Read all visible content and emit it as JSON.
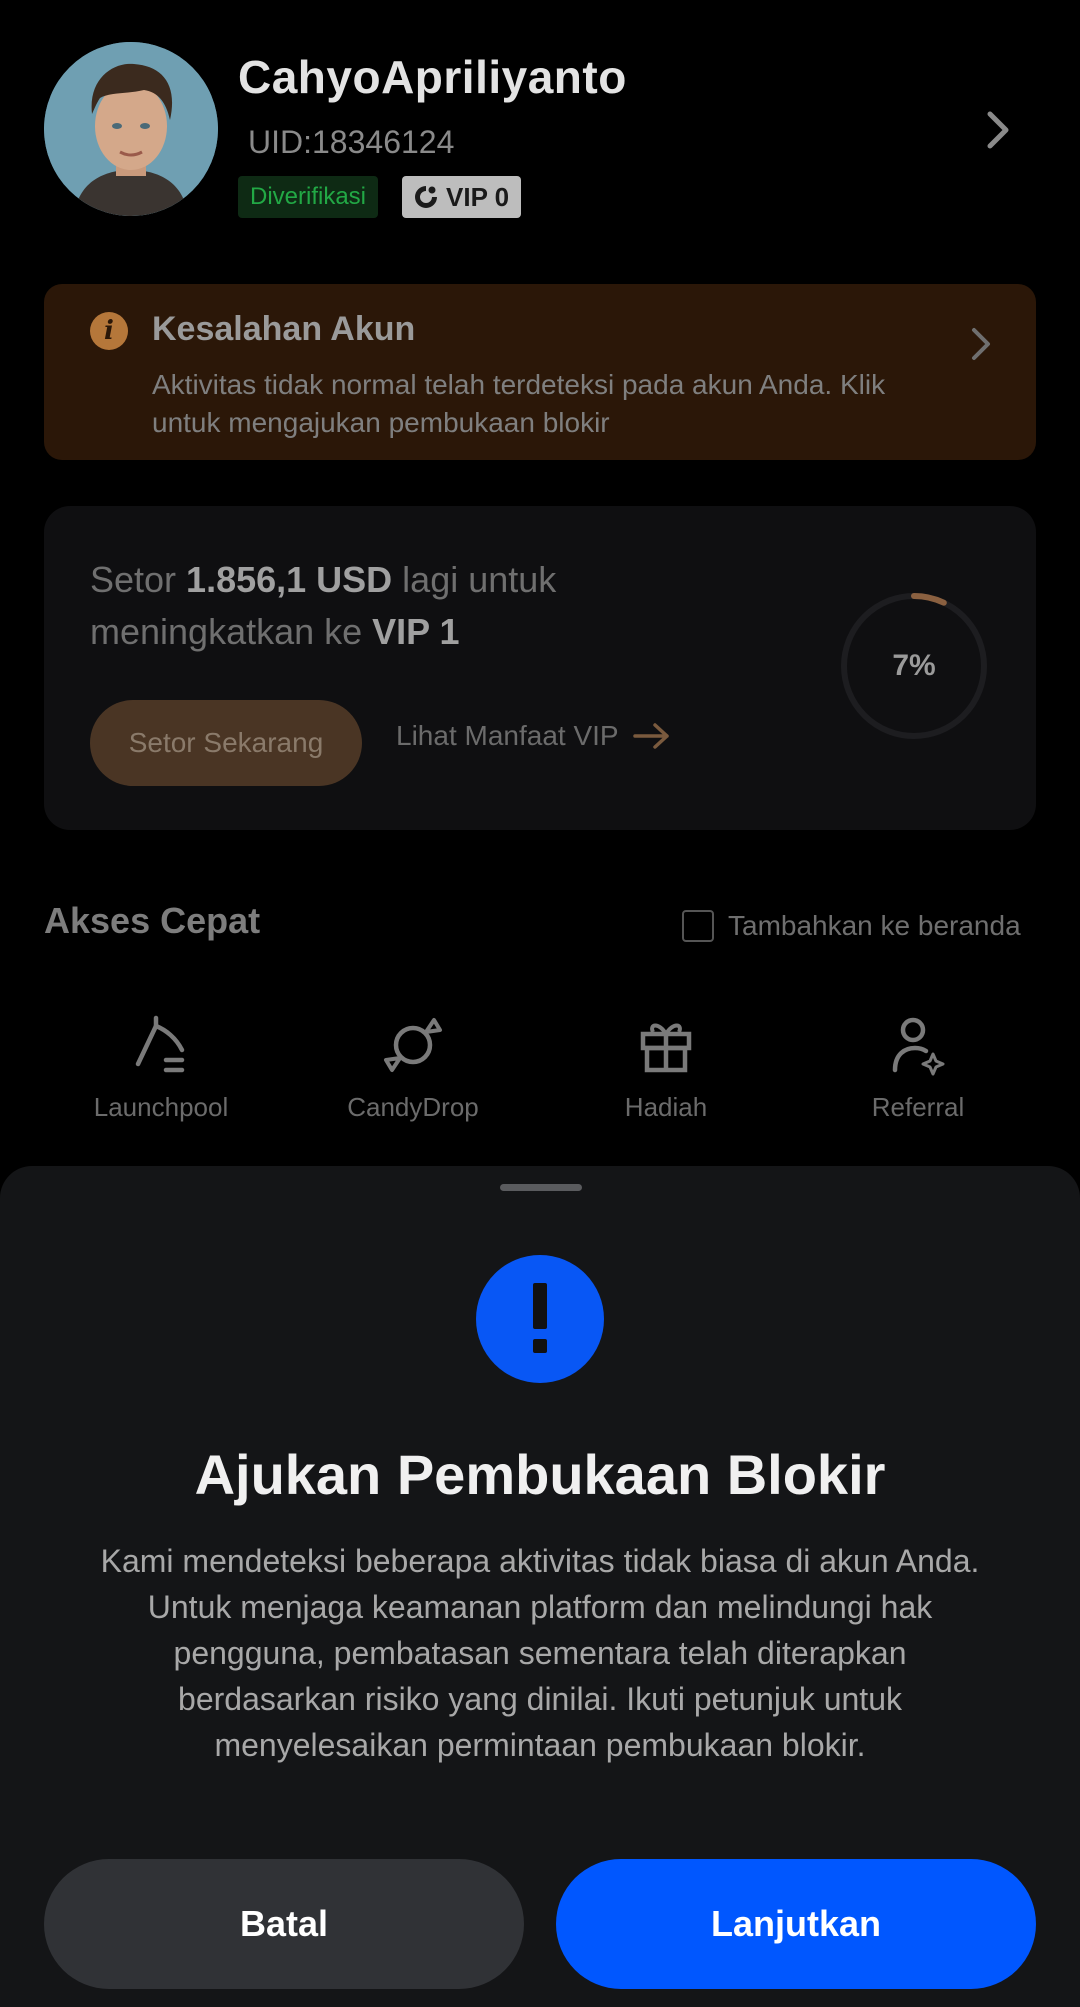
{
  "profile": {
    "username": "CahyoApriliyanto",
    "uid": "UID:18346124",
    "verified_label": "Diverifikasi",
    "vip_label": "VIP 0",
    "avatar_icon": "user-avatar-photo",
    "chevron_icon": "chevron-right-icon"
  },
  "alert": {
    "icon": "info-icon",
    "icon_glyph": "i",
    "title": "Kesalahan Akun",
    "text": "Aktivitas tidak normal telah terdeteksi pada akun Anda. Klik untuk mengajukan pembukaan blokir",
    "chevron_icon": "chevron-right-icon"
  },
  "vip_card": {
    "text_prefix": "Setor ",
    "amount": "1.856,1 USD",
    "text_middle": " lagi untuk meningkatkan ke ",
    "target_level": "VIP 1",
    "deposit_button": "Setor Sekarang",
    "benefit_link": "Lihat Manfaat VIP",
    "progress_label": "7%",
    "progress_fraction": 0.07
  },
  "quick_access": {
    "title": "Akses Cepat",
    "checkbox_label": "Tambahkan ke beranda",
    "items": [
      {
        "label": "Launchpool",
        "icon": "launchpool-icon"
      },
      {
        "label": "CandyDrop",
        "icon": "candy-icon"
      },
      {
        "label": "Hadiah",
        "icon": "gift-icon"
      },
      {
        "label": "Referral",
        "icon": "referral-user-icon"
      }
    ]
  },
  "sheet": {
    "icon": "exclamation-icon",
    "title": "Ajukan Pembukaan Blokir",
    "text": "Kami mendeteksi beberapa aktivitas tidak biasa di akun Anda. Untuk menjaga keamanan platform dan melindungi hak pengguna, pembatasan sementara telah diterapkan berdasarkan risiko yang dinilai. Ikuti petunjuk untuk menyelesaikan permintaan pembukaan blokir.",
    "cancel_button": "Batal",
    "continue_button": "Lanjutkan"
  },
  "colors": {
    "accent_blue": "#0057ff",
    "alert_bg": "#2b1708",
    "verified_green": "#22a845",
    "progress_arc": "#8a6040"
  }
}
